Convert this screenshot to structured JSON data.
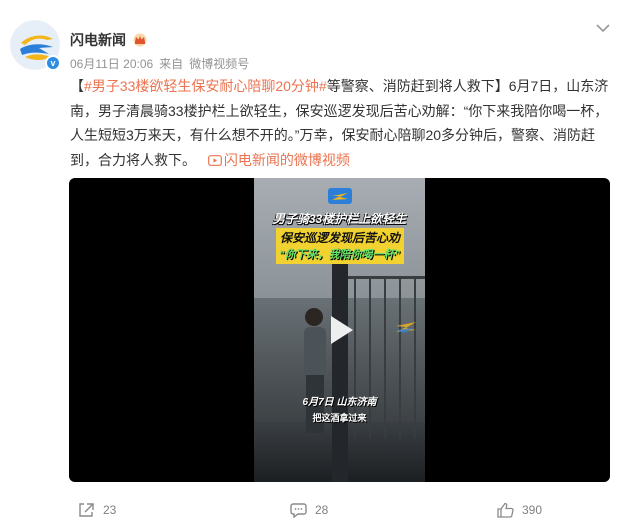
{
  "post": {
    "author": "闪电新闻",
    "meta": {
      "date": "06月11日 20:06",
      "source_prefix": "来自",
      "source": "微博视频号"
    },
    "text": {
      "bracket_open": "【",
      "topic": "#男子33楼欲轻生保安耐心陪聊20分钟#",
      "headline_rest": "等警察、消防赶到将人救下",
      "bracket_close": "】",
      "body": "6月7日，山东济南，男子清晨骑33楼护栏上欲轻生，保安巡逻发现后苦心劝解：“你下来我陪你喝一杯，人生短短3万来天，有什么想不开的。”万幸，保安耐心陪聊20多分钟后，警察、消防赶到，合力将人救下。",
      "video_link": "闪电新闻的微博视频"
    },
    "video": {
      "caption_line1": "男子骑33楼护栏上欲轻生",
      "caption_line2": "保安巡逻发现后苦心劝解",
      "caption_line3": "“你下来，我陪你喝一杯”",
      "caption_date": "6月7日 山东济南",
      "subtitle": "把这酒拿过来"
    },
    "actions": {
      "forward_count": "23",
      "comment_count": "28",
      "like_count": "390"
    }
  },
  "icons": {
    "more": "chevron-down-icon",
    "vip": "crown-icon",
    "verified": "verified-badge-icon",
    "forward": "share-icon",
    "comment": "comment-icon",
    "like": "thumbs-up-icon",
    "play": "play-icon",
    "link": "video-link-icon"
  },
  "colors": {
    "accent": "#eb7350",
    "meta_text": "#939393",
    "verified": "#2b8de4"
  }
}
